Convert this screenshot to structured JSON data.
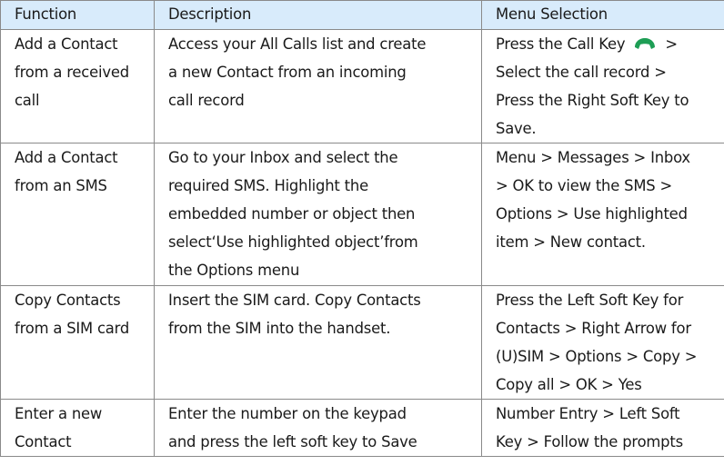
{
  "headers": [
    "Function",
    "Description",
    "Menu Selection"
  ],
  "rows": [
    {
      "function": [
        "Add a Contact",
        "from a received",
        "call"
      ],
      "description": [
        "Access your All Calls list and create",
        "a new Contact from an incoming",
        "call record"
      ],
      "menu": {
        "first_line_text": "Press the Call Key",
        "first_line_icon": "phone-handset-icon",
        "first_line_suffix": ">",
        "lines": [
          "Select the call record >",
          "Press the Right Soft Key to",
          "Save."
        ]
      }
    },
    {
      "function": [
        "Add a Contact",
        "from an SMS"
      ],
      "description": [
        "Go to your Inbox and select the",
        "required SMS. Highlight the",
        "embedded number or object then",
        "select‘Use highlighted object’from",
        "the Options menu"
      ],
      "menu": {
        "lines": [
          "Menu > Messages > Inbox",
          "> OK to view the SMS >",
          "Options > Use highlighted",
          "item > New contact."
        ]
      }
    },
    {
      "function": [
        "Copy Contacts",
        "from a SIM card"
      ],
      "description": [
        "Insert the SIM card. Copy Contacts",
        "from the SIM into the handset."
      ],
      "menu": {
        "lines": [
          "Press the Left Soft Key for",
          "Contacts > Right Arrow for",
          "(U)SIM > Options > Copy >",
          "Copy all > OK > Yes"
        ]
      }
    },
    {
      "function": [
        "Enter a new",
        "Contact"
      ],
      "description": [
        "Enter the number on the keypad",
        "and press the left soft key to Save"
      ],
      "menu": {
        "lines": [
          "Number Entry > Left Soft",
          "Key > Follow the prompts"
        ]
      }
    }
  ],
  "colors": {
    "header_bg": "#d8ebfb",
    "border": "#8a8a8a",
    "icon": "#1e9e55"
  }
}
